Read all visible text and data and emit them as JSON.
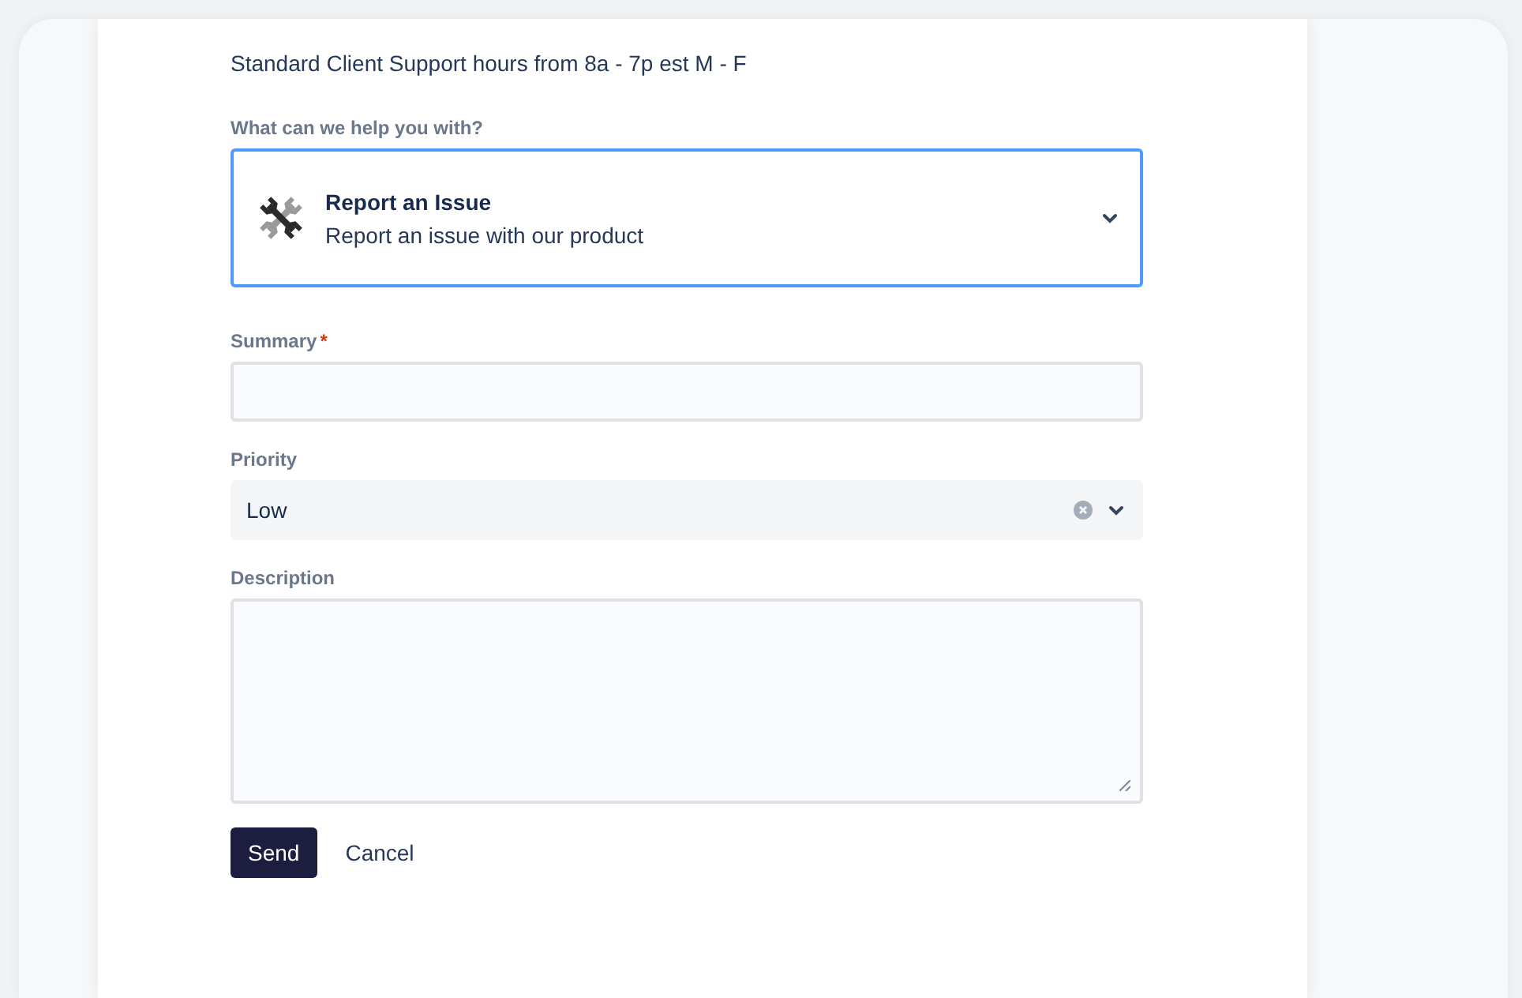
{
  "intro": "Standard Client Support hours from 8a - 7p est M - F",
  "request_type": {
    "label": "What can we help you with?",
    "title": "Report an Issue",
    "description": "Report an issue with our product",
    "focused": true
  },
  "fields": [
    {
      "kind": "text",
      "label": "Summary",
      "required": true
    },
    {
      "kind": "select",
      "label": "Priority",
      "required": false,
      "value": "Low"
    },
    {
      "kind": "textarea",
      "label": "Description",
      "required": false
    }
  ],
  "required_mark": "*",
  "buttons": {
    "submit": "Send",
    "cancel": "Cancel"
  }
}
